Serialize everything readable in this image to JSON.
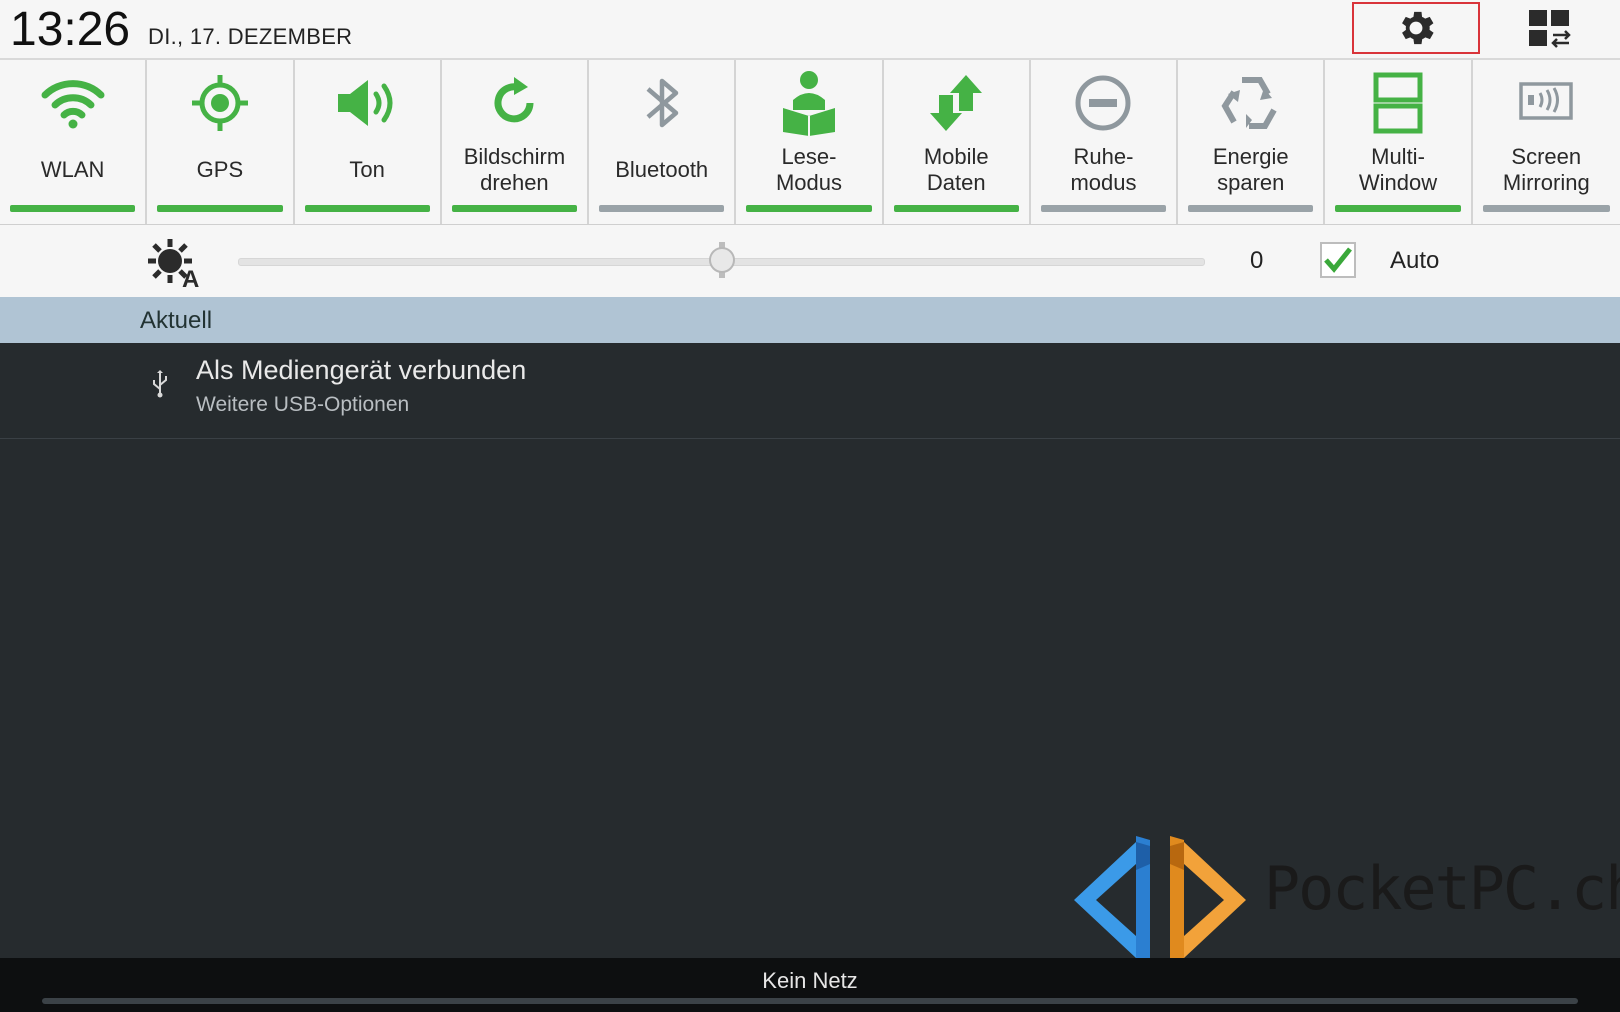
{
  "status": {
    "time": "13:26",
    "date": "DI., 17. DEZEMBER"
  },
  "toolbar": {
    "settings_icon": "gear-icon",
    "grid_icon": "quick-panel-edit-icon"
  },
  "toggles": [
    {
      "label": "WLAN",
      "icon": "wifi-icon",
      "active": true
    },
    {
      "label": "GPS",
      "icon": "gps-icon",
      "active": true
    },
    {
      "label": "Ton",
      "icon": "speaker-icon",
      "active": true
    },
    {
      "label": "Bildschirm\ndrehen",
      "icon": "rotate-icon",
      "active": true
    },
    {
      "label": "Bluetooth",
      "icon": "bluetooth-icon",
      "active": false
    },
    {
      "label": "Lese-\nModus",
      "icon": "reading-icon",
      "active": true
    },
    {
      "label": "Mobile\nDaten",
      "icon": "mobile-data-icon",
      "active": true
    },
    {
      "label": "Ruhe-\nmodus",
      "icon": "do-not-disturb-icon",
      "active": false
    },
    {
      "label": "Energie\nsparen",
      "icon": "recycle-icon",
      "active": false
    },
    {
      "label": "Multi-\nWindow",
      "icon": "multi-window-icon",
      "active": true
    },
    {
      "label": "Screen\nMirroring",
      "icon": "screen-mirroring-icon",
      "active": false
    }
  ],
  "brightness": {
    "value": "0",
    "level": 0.5,
    "auto_label": "Auto",
    "auto_checked": true
  },
  "section": {
    "title": "Aktuell"
  },
  "notification": {
    "title": "Als Mediengerät verbunden",
    "subtitle": "Weitere USB-Optionen",
    "icon": "usb-icon"
  },
  "watermark": {
    "text": "PocketPC.ch"
  },
  "bottom": {
    "network": "Kein Netz"
  },
  "colors": {
    "accent": "#45b245",
    "inactive": "#9aa3a8",
    "highlight": "#d9343a"
  }
}
